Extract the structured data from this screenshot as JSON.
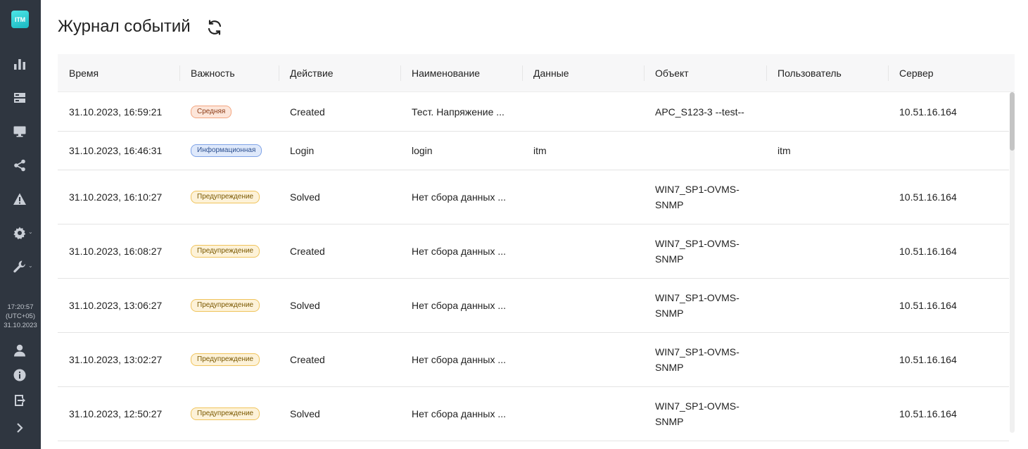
{
  "app": {
    "logo_text": "ITM"
  },
  "sidebar": {
    "items": [
      {
        "icon": "bar-chart-icon"
      },
      {
        "icon": "server-icon"
      },
      {
        "icon": "monitor-icon"
      },
      {
        "icon": "share-icon"
      },
      {
        "icon": "warning-icon"
      },
      {
        "icon": "gear-icon",
        "caret": "⌄"
      },
      {
        "icon": "wrench-icon",
        "caret": "⌄"
      }
    ],
    "clock": {
      "time": "17:20:57",
      "tz": "(UTC+05)",
      "date": "31.10.2023"
    },
    "bottom": [
      {
        "icon": "user-icon"
      },
      {
        "icon": "info-icon"
      },
      {
        "icon": "logout-icon"
      },
      {
        "icon": "expand-chevron-icon"
      }
    ]
  },
  "header": {
    "title": "Журнал событий",
    "refresh_icon": "refresh-icon"
  },
  "table": {
    "columns": [
      "Время",
      "Важность",
      "Действие",
      "Наименование",
      "Данные",
      "Объект",
      "Пользователь",
      "Сервер"
    ],
    "rows": [
      {
        "time": "31.10.2023, 16:59:21",
        "severity": "Средняя",
        "severity_type": "medium",
        "action": "Created",
        "name": "Тест. Напряжение ...",
        "data": "",
        "object_l1": "APC_S123-3 --test--",
        "object_l2": "",
        "user": "",
        "server": "10.51.16.164"
      },
      {
        "time": "31.10.2023, 16:46:31",
        "severity": "Информационная",
        "severity_type": "info",
        "action": "Login",
        "name": "login",
        "data": "itm",
        "object_l1": "",
        "object_l2": "",
        "user": "itm",
        "server": ""
      },
      {
        "time": "31.10.2023, 16:10:27",
        "severity": "Предупреждение",
        "severity_type": "warn",
        "action": "Solved",
        "name": "Нет сбора данных ...",
        "data": "",
        "object_l1": "WIN7_SP1-OVMS-",
        "object_l2": "SNMP",
        "user": "",
        "server": "10.51.16.164"
      },
      {
        "time": "31.10.2023, 16:08:27",
        "severity": "Предупреждение",
        "severity_type": "warn",
        "action": "Created",
        "name": "Нет сбора данных ...",
        "data": "",
        "object_l1": "WIN7_SP1-OVMS-",
        "object_l2": "SNMP",
        "user": "",
        "server": "10.51.16.164"
      },
      {
        "time": "31.10.2023, 13:06:27",
        "severity": "Предупреждение",
        "severity_type": "warn",
        "action": "Solved",
        "name": "Нет сбора данных ...",
        "data": "",
        "object_l1": "WIN7_SP1-OVMS-",
        "object_l2": "SNMP",
        "user": "",
        "server": "10.51.16.164"
      },
      {
        "time": "31.10.2023, 13:02:27",
        "severity": "Предупреждение",
        "severity_type": "warn",
        "action": "Created",
        "name": "Нет сбора данных ...",
        "data": "",
        "object_l1": "WIN7_SP1-OVMS-",
        "object_l2": "SNMP",
        "user": "",
        "server": "10.51.16.164"
      },
      {
        "time": "31.10.2023, 12:50:27",
        "severity": "Предупреждение",
        "severity_type": "warn",
        "action": "Solved",
        "name": "Нет сбора данных ...",
        "data": "",
        "object_l1": "WIN7_SP1-OVMS-",
        "object_l2": "SNMP",
        "user": "",
        "server": "10.51.16.164"
      }
    ]
  },
  "colors": {
    "sidebar_bg": "#2f3640",
    "accent": "#1ab8c2",
    "header_bg": "#f7f7f8"
  }
}
